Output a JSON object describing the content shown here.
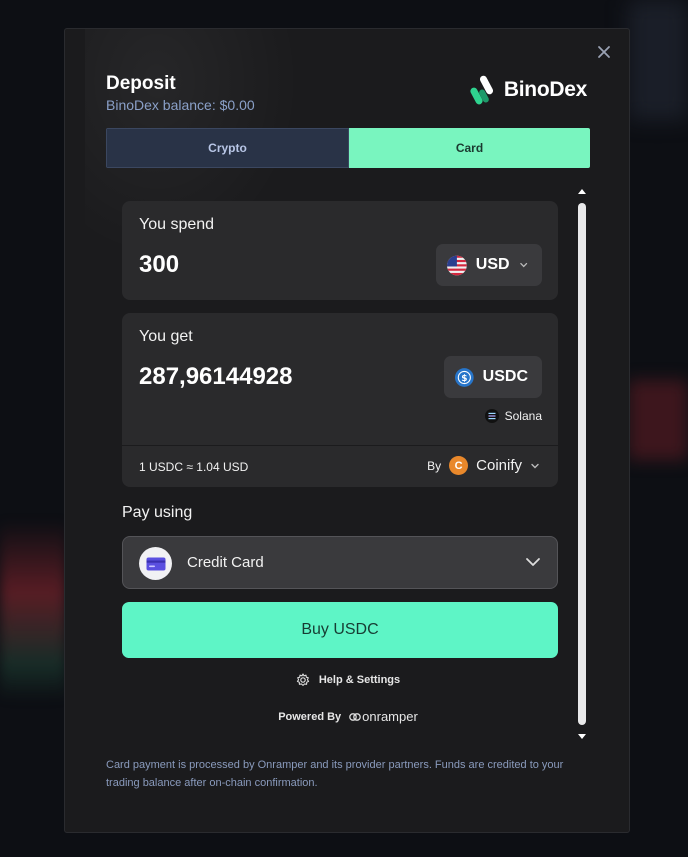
{
  "modal": {
    "title": "Deposit",
    "balance": "BinoDex balance: $0.00",
    "brand_name": "BinoDex",
    "close_icon": "close-icon"
  },
  "tabs": [
    {
      "label": "Crypto",
      "active": false
    },
    {
      "label": "Card",
      "active": true
    }
  ],
  "spend": {
    "label": "You spend",
    "amount": "300",
    "currency": "USD",
    "currency_icon": "us-flag-icon"
  },
  "get": {
    "label": "You get",
    "amount": "287,96144928",
    "currency": "USDC",
    "currency_icon": "usdc-icon",
    "network": "Solana",
    "network_icon": "solana-icon"
  },
  "quote": {
    "rate": "1 USDC ≈ 1.04 USD",
    "by_label": "By",
    "provider": "Coinify",
    "provider_initial": "C"
  },
  "payment": {
    "label": "Pay using",
    "method": "Credit Card",
    "method_icon": "credit-card-icon"
  },
  "buy_button": "Buy USDC",
  "help_link": "Help & Settings",
  "powered_by": {
    "label": "Powered By",
    "partner": "onramper"
  },
  "footnote": "Card payment is processed by Onramper and its provider partners. Funds are credited to your trading balance after on-chain confirmation.",
  "colors": {
    "accent": "#5ef5c6",
    "tab_active": "#79f5bf",
    "tab_inactive": "#293347",
    "modal_bg": "#1b1b1d",
    "card_bg": "#2a2a2c",
    "provider": "#e9882b"
  }
}
